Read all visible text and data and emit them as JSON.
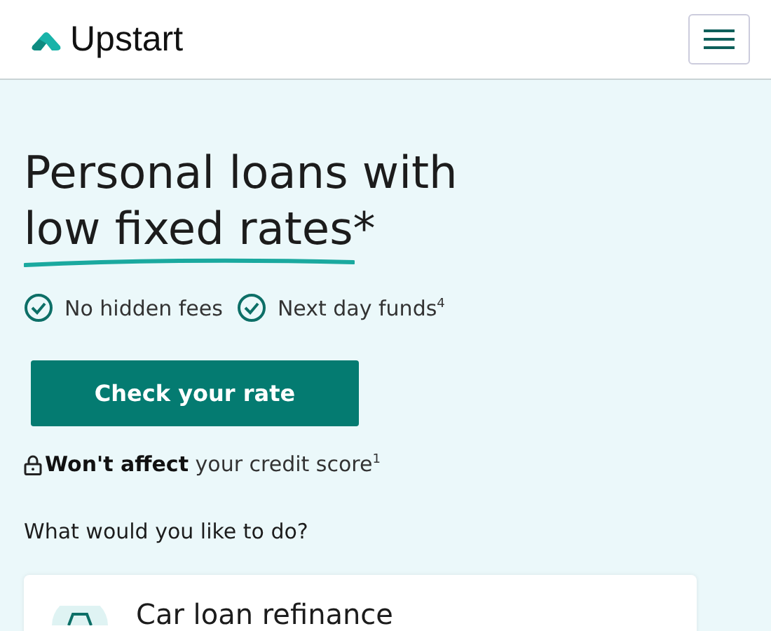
{
  "header": {
    "brand": "Upstart"
  },
  "hero": {
    "headline": "Personal loans with",
    "headline_highlight": "low fixed rates*",
    "features": [
      "No hidden fees",
      "Next day funds$^{4}$"
    ],
    "cta": "Check your rate",
    "note": "**Won't affect** your credit score$^{1}$"
  },
  "options": {
    "prompt": "What would you like to do?",
    "items": [
      {
        "title": "Car loan refinance"
      }
    ]
  }
}
